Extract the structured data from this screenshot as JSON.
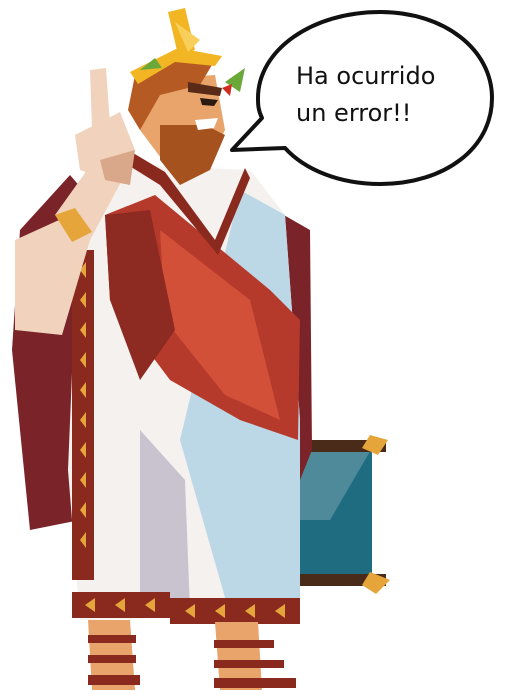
{
  "speech_bubble": {
    "lines": [
      "Ha ocurrido",
      "un error!!"
    ]
  },
  "illustration": {
    "subject": "roman-emperor-character",
    "props": [
      "laurel-crown",
      "scroll"
    ]
  },
  "colors": {
    "background": "#ffffff",
    "toga_white": "#f4f1ee",
    "toga_shadow": "#bcd7e6",
    "sash_red": "#b63a2b",
    "cape_dark_red": "#7a2328",
    "trim_brown": "#8a2a1e",
    "trim_gold": "#e6a53a",
    "skin": "#f0d2bd",
    "hair_beard": "#b55a22",
    "crown_gold": "#f2b624",
    "scroll_teal": "#1f6c80",
    "scroll_rod": "#a06522",
    "bubble_stroke": "#111111"
  }
}
